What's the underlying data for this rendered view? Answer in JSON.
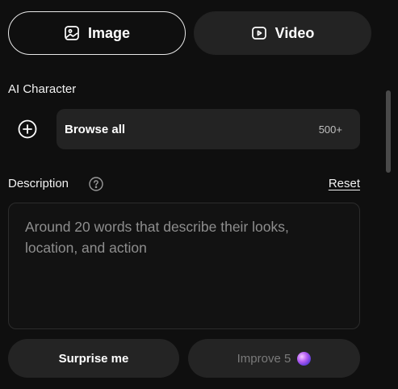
{
  "tabs": [
    {
      "label": "Image",
      "icon": "image-icon",
      "active": true
    },
    {
      "label": "Video",
      "icon": "play-icon",
      "active": false
    }
  ],
  "ai_character": {
    "label": "AI Character",
    "add_icon": "plus-circle-icon",
    "browse_label": "Browse all",
    "browse_count": "500+"
  },
  "description": {
    "label": "Description",
    "help_icon": "question-circle-icon",
    "reset_label": "Reset",
    "value": "",
    "placeholder": "Around 20 words that describe their looks, location, and action"
  },
  "actions": {
    "surprise_label": "Surprise me",
    "improve_label": "Improve 5",
    "improve_icon": "gem-icon"
  },
  "colors": {
    "background": "#0f0f0f",
    "surface": "#232323",
    "text": "#ffffff",
    "muted": "#8e8e8e",
    "gem_accent": "#b45cf2"
  }
}
